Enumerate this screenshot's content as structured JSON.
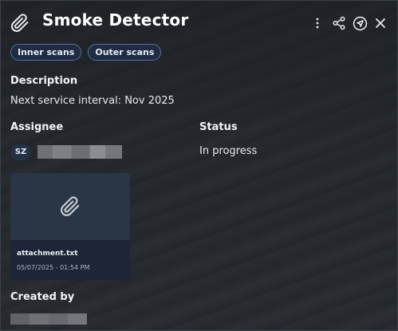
{
  "header": {
    "title": "Smoke Detector"
  },
  "tags": [
    "Inner scans",
    "Outer scans"
  ],
  "description": {
    "label": "Description",
    "value": "Next service interval: Nov 2025"
  },
  "assignee": {
    "label": "Assignee",
    "initials": "SZ"
  },
  "status": {
    "label": "Status",
    "value": "In progress"
  },
  "attachment": {
    "name": "attachment.txt",
    "date": "05/07/2025 - 01:54 PM"
  },
  "created_by": {
    "label": "Created by"
  },
  "icons": {
    "header": "paperclip-icon",
    "more": "more-vertical-icon",
    "share": "share-icon",
    "navigate": "navigate-icon",
    "close": "close-icon",
    "attachment": "paperclip-icon"
  },
  "colors": {
    "tag_border": "#56709a",
    "tag_bg": "#1f2c44",
    "card_bg": "#1d2636"
  }
}
